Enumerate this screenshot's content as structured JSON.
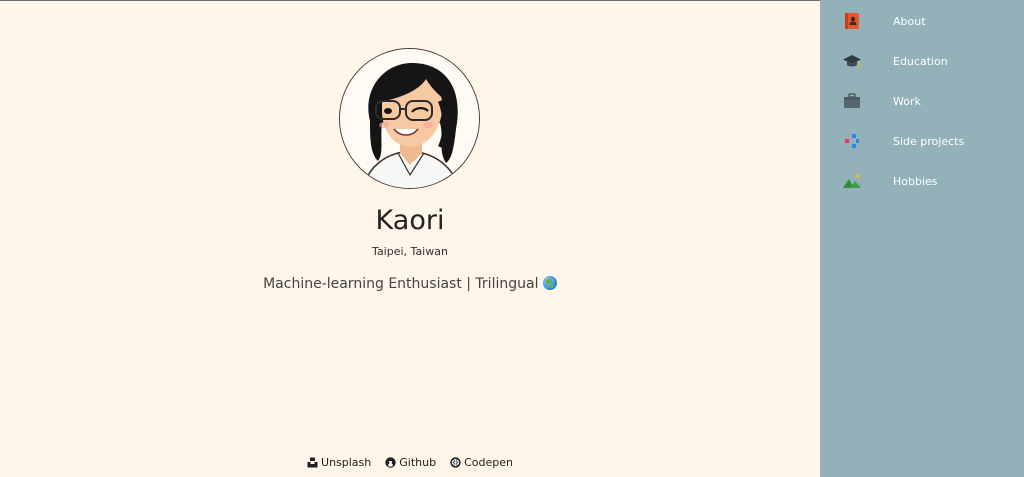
{
  "profile": {
    "name": "Kaori",
    "location": "Taipei, Taiwan",
    "tagline": "Machine-learning Enthusiast | Trilingual",
    "tagline_icon": "globe-icon",
    "avatar": "cartoon-portrait"
  },
  "footer": {
    "links": [
      {
        "label": "Unsplash",
        "icon": "unsplash-icon"
      },
      {
        "label": "Github",
        "icon": "github-icon"
      },
      {
        "label": "Codepen",
        "icon": "codepen-icon"
      }
    ]
  },
  "sidebar": {
    "background": "#93b1b8",
    "items": [
      {
        "label": "About",
        "icon": "address-book-icon"
      },
      {
        "label": "Education",
        "icon": "graduation-cap-icon"
      },
      {
        "label": "Work",
        "icon": "briefcase-icon"
      },
      {
        "label": "Side projects",
        "icon": "blocks-icon"
      },
      {
        "label": "Hobbies",
        "icon": "mountain-icon"
      }
    ]
  },
  "colors": {
    "page_background": "#fff5e8",
    "sidebar_background": "#93b1b8",
    "text": "#2b2b2b"
  }
}
